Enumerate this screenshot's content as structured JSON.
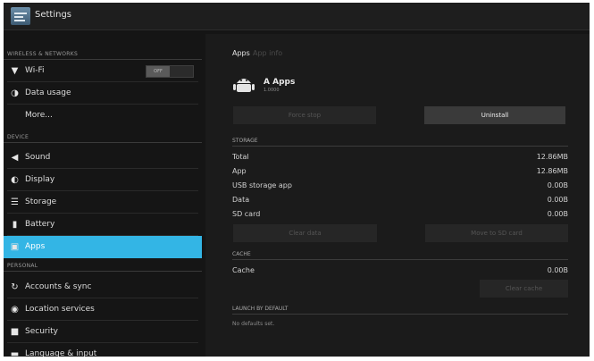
{
  "actionbar": {
    "title": "Settings"
  },
  "sidebar": {
    "sections": {
      "wireless": "WIRELESS & NETWORKS",
      "device": "DEVICE",
      "personal": "PERSONAL"
    },
    "items": [
      {
        "label": "Wi-Fi",
        "icon": "wifi-icon"
      },
      {
        "label": "Data usage",
        "icon": "data-usage-icon"
      },
      {
        "label": "More..."
      },
      {
        "label": "Sound",
        "icon": "speaker-icon"
      },
      {
        "label": "Display",
        "icon": "brightness-icon"
      },
      {
        "label": "Storage",
        "icon": "storage-icon"
      },
      {
        "label": "Battery",
        "icon": "battery-icon"
      },
      {
        "label": "Apps",
        "icon": "apps-icon",
        "selected": true
      },
      {
        "label": "Accounts & sync",
        "icon": "sync-icon"
      },
      {
        "label": "Location services",
        "icon": "location-icon"
      },
      {
        "label": "Security",
        "icon": "lock-icon"
      },
      {
        "label": "Language & input",
        "icon": "keyboard-icon"
      }
    ],
    "wifi_toggle": "OFF"
  },
  "content": {
    "breadcrumb": {
      "current": "Apps",
      "sub": "App info"
    },
    "app": {
      "name": "A Apps",
      "version": "1.0000",
      "icon": "android-icon"
    },
    "buttons": {
      "force_stop": "Force stop",
      "uninstall": "Uninstall",
      "clear_data": "Clear data",
      "move_to_sd": "Move to SD card",
      "clear_cache": "Clear cache"
    },
    "storage": {
      "header": "STORAGE",
      "rows": [
        {
          "label": "Total",
          "value": "12.86MB"
        },
        {
          "label": "App",
          "value": "12.86MB"
        },
        {
          "label": "USB storage app",
          "value": "0.00B"
        },
        {
          "label": "Data",
          "value": "0.00B"
        },
        {
          "label": "SD card",
          "value": "0.00B"
        }
      ]
    },
    "cache": {
      "header": "CACHE",
      "label": "Cache",
      "value": "0.00B"
    },
    "launch": {
      "header": "LAUNCH BY DEFAULT",
      "text": "No defaults set."
    }
  },
  "colors": {
    "accent": "#33b5e5",
    "background": "#151515"
  }
}
